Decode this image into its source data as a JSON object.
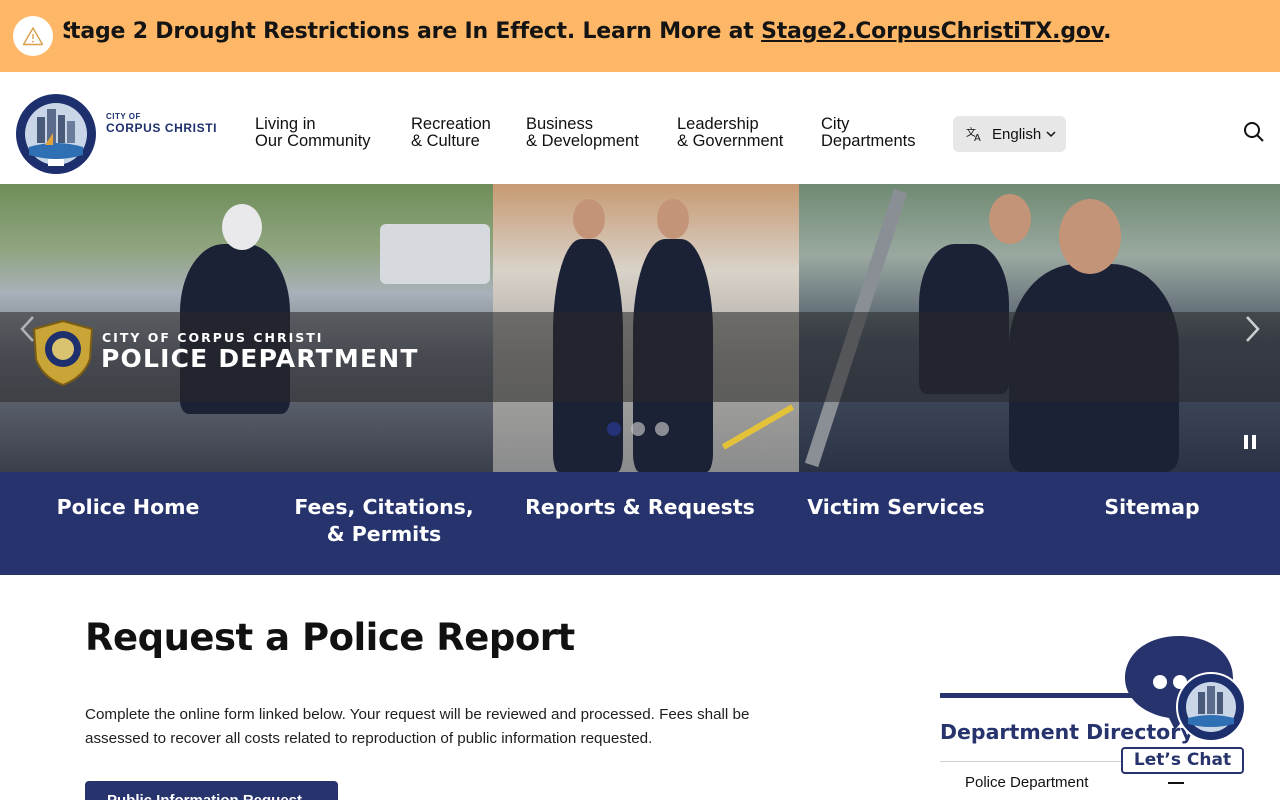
{
  "alert": {
    "text_clip": "S",
    "text": "tage 2 Drought Restrictions are In Effect. Learn More at ",
    "link": "Stage2.CorpusChristiTX.gov",
    "end": "."
  },
  "header": {
    "logo_small": "CITY OF",
    "logo_big": "CORPUS CHRISTI",
    "nav": [
      {
        "line1": "Living in",
        "line2": "Our Community"
      },
      {
        "line1": "Recreation",
        "line2": "& Culture"
      },
      {
        "line1": "Business",
        "line2": "& Development"
      },
      {
        "line1": "Leadership",
        "line2": "& Government"
      },
      {
        "line1": "City",
        "line2": "Departments"
      }
    ],
    "language": "English"
  },
  "hero": {
    "pd_small": "CITY OF CORPUS CHRISTI",
    "pd_big": "POLICE DEPARTMENT",
    "slides": 3,
    "active_slide": 1
  },
  "subnav": [
    {
      "label": "Police Home"
    },
    {
      "label": "Fees, Citations, & Permits"
    },
    {
      "label": "Reports & Requests"
    },
    {
      "label": "Victim Services"
    },
    {
      "label": "Sitemap"
    }
  ],
  "main": {
    "title": "Request a Police Report",
    "paragraph": "Complete the online form linked below. Your request will be reviewed and processed. Fees shall be assessed to recover all costs related to reproduction of public information requested.",
    "button": "Public Information Request"
  },
  "sidebar": {
    "title": "Department Directory",
    "item": "Police Department"
  },
  "chat": {
    "label": "Let’s Chat"
  },
  "colors": {
    "alert_bg": "#fdb766",
    "brand_navy": "#27336d",
    "active_dot": "#24327a"
  }
}
